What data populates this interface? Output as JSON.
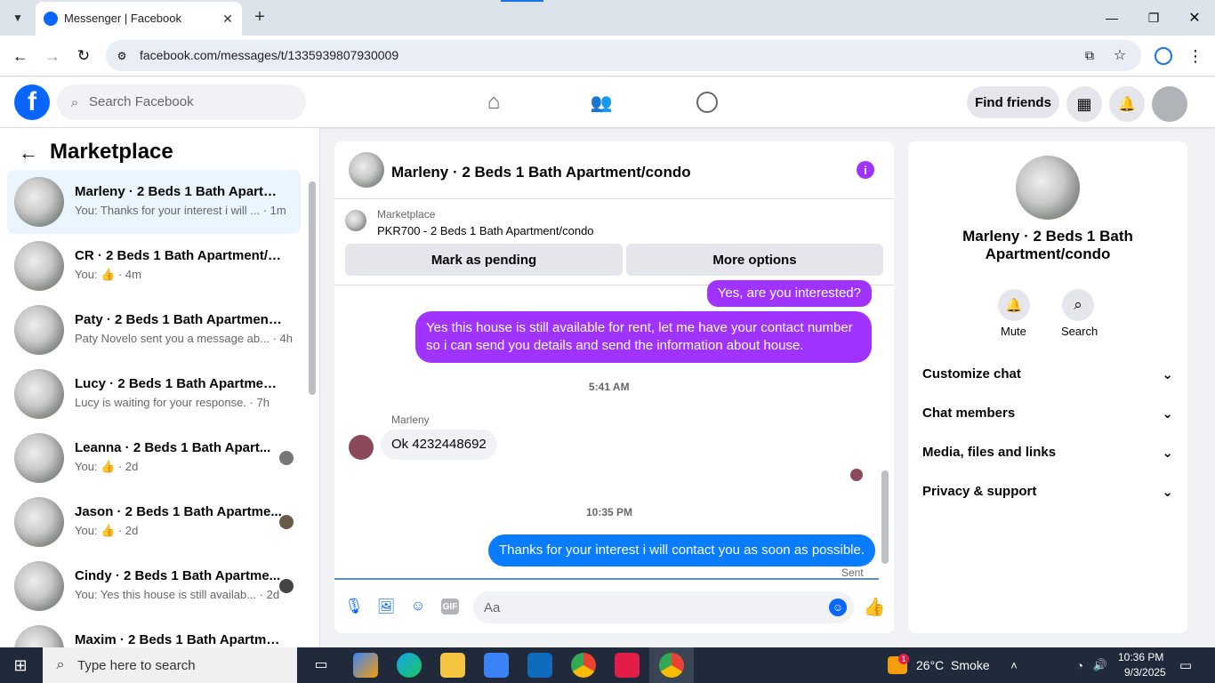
{
  "browser": {
    "tab_title": "Messenger | Facebook",
    "url": "facebook.com/messages/t/1335939807930009"
  },
  "fb": {
    "search_placeholder": "Search Facebook",
    "find_friends": "Find friends"
  },
  "sidebar": {
    "title": "Marketplace",
    "conversations": [
      {
        "title": "Marleny · 2 Beds 1 Bath Apartm...",
        "sub": "You: Thanks for your interest i will ... · 1m"
      },
      {
        "title": "CR · 2 Beds 1 Bath Apartment/co...",
        "sub": "You:",
        "time": " · 4m"
      },
      {
        "title": "Paty · 2 Beds 1 Bath Apartment/...",
        "sub": "Paty Novelo sent you a message ab... · 4h"
      },
      {
        "title": "Lucy · 2 Beds 1 Bath Apartment/...",
        "sub": "Lucy is waiting for your response. · 7h"
      },
      {
        "title": "Leanna · 2 Beds 1 Bath Apart...",
        "sub": "You:",
        "time": " · 2d"
      },
      {
        "title": "Jason · 2 Beds 1 Bath Apartme...",
        "sub": "You:",
        "time": " · 2d"
      },
      {
        "title": "Cindy · 2 Beds 1 Bath Apartme...",
        "sub": "You: Yes this house is still availab... · 2d"
      },
      {
        "title": "Maxim · 2 Beds 1 Bath Apartme...",
        "sub": ""
      }
    ]
  },
  "chat": {
    "title": "Marleny · 2 Beds 1 Bath Apartment/condo",
    "marketplace_label": "Marketplace",
    "listing": "PKR700 - 2 Beds 1 Bath Apartment/condo",
    "mark_pending": "Mark as pending",
    "more_options": "More options",
    "msg1": "Yes, are you interested?",
    "msg2": "Yes this house is still available for rent, let me have your contact number so i can send you details and send the information about house.",
    "time1": "5:41 AM",
    "sender": "Marleny",
    "msg3": "Ok 4232448692",
    "time2": "10:35 PM",
    "msg4": "Thanks for your interest i will contact you as soon as possible.",
    "sent": "Sent",
    "input_placeholder": "Aa"
  },
  "info": {
    "name": "Marleny · 2 Beds 1 Bath Apartment/condo",
    "mute": "Mute",
    "search": "Search",
    "sections": [
      "Customize chat",
      "Chat members",
      "Media, files and links",
      "Privacy & support"
    ]
  },
  "taskbar": {
    "search_placeholder": "Type here to search",
    "weather": "26°C  Smoke",
    "time": "10:36 PM",
    "date": "9/3/2025",
    "weather_badge": "1"
  },
  "colors": {
    "fb_blue": "#0866ff",
    "purple": "#a033ff",
    "blue_bubble": "#0a7cff"
  }
}
